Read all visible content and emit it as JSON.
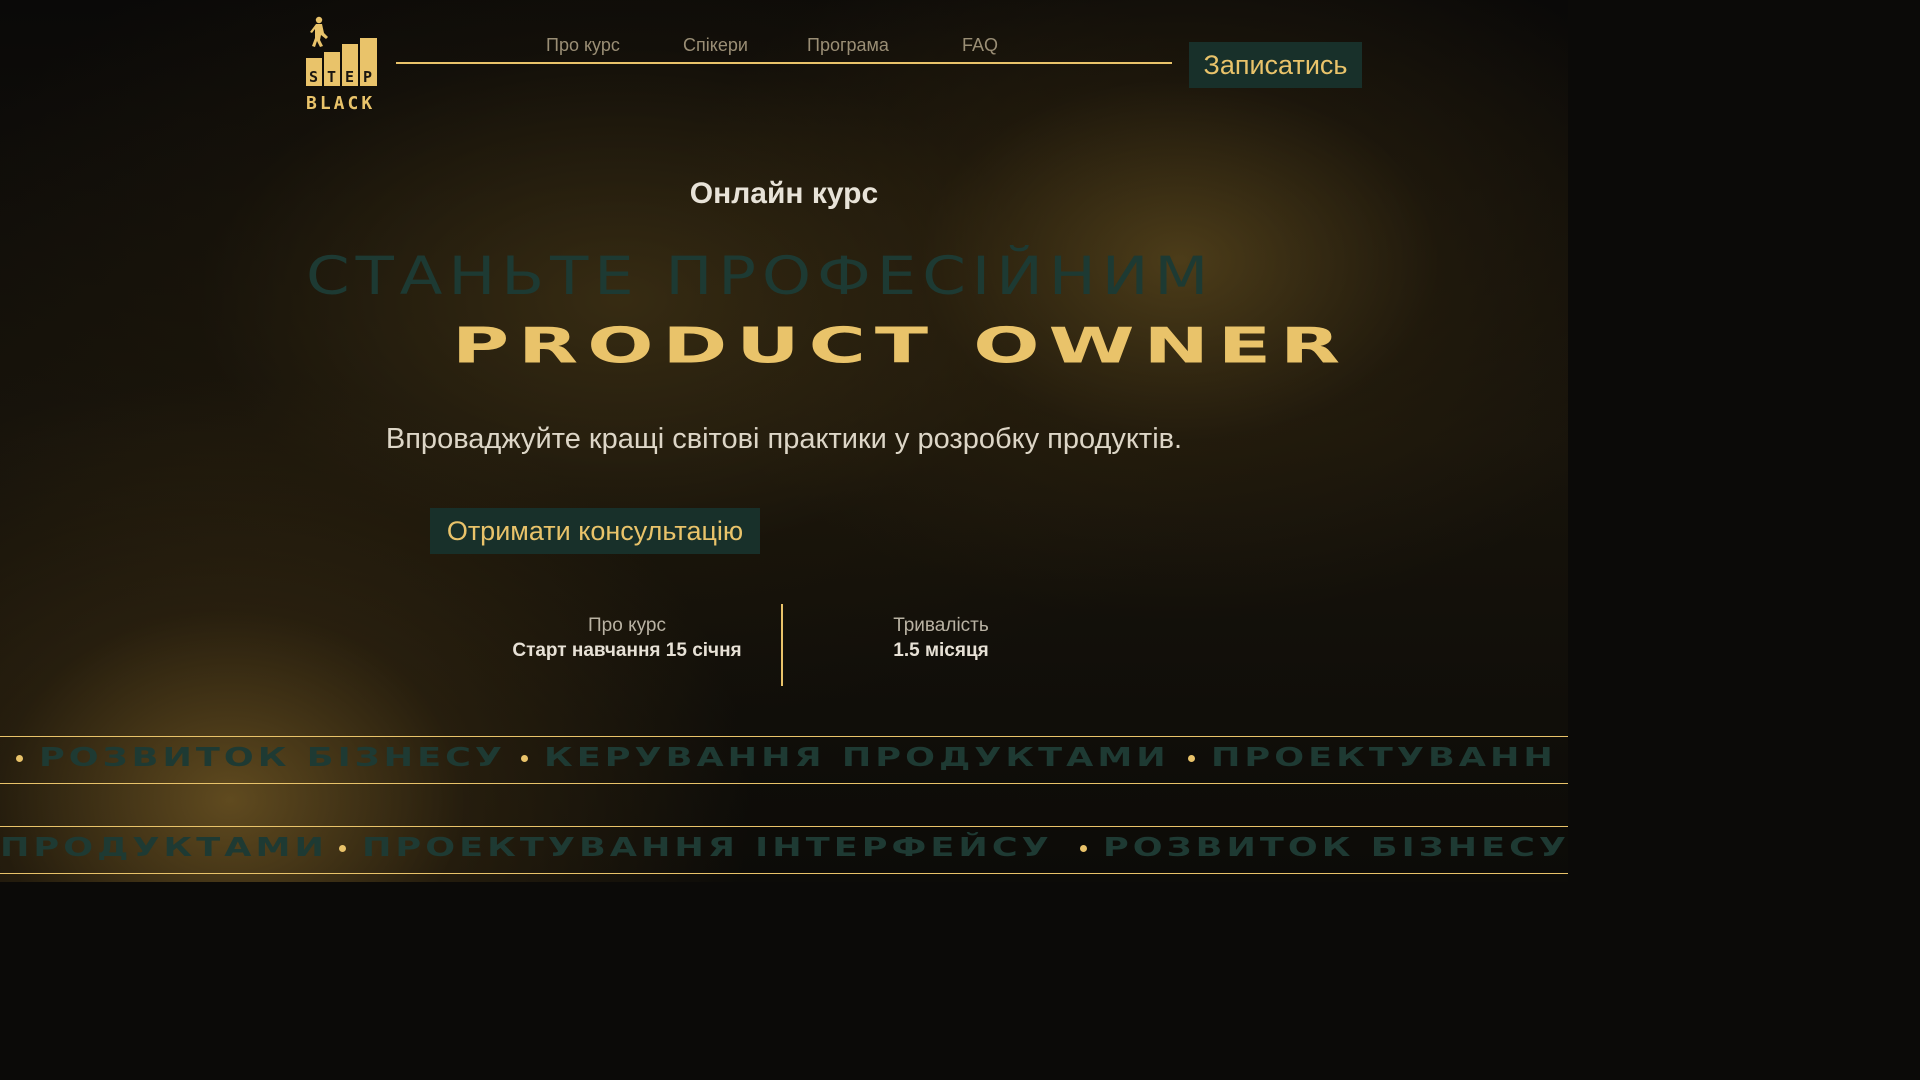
{
  "brand": {
    "logo_line1": "STEP",
    "logo_line2": "BLACK",
    "gold": "#e9c36a",
    "dark_green": "#18302a"
  },
  "nav": {
    "links": [
      "Про курс",
      "Спікери",
      "Програма",
      "FAQ"
    ],
    "cta_label": "Записатись"
  },
  "hero": {
    "kicker": "Онлайн курс",
    "headline_line1": "СТАНЬТЕ ПРОФЕСІЙНИМ",
    "headline_line2": "PRODUCT OWNER",
    "subtitle": "Впроваджуйте кращі світові практики у розробку продуктів.",
    "cta_label": "Отримати консультацію"
  },
  "info": [
    {
      "label": "Про курс",
      "value": "Старт навчання 15 січня"
    },
    {
      "label": "Тривалість",
      "value": "1.5 місяця"
    }
  ],
  "ticker_top": [
    "РОЗВИТОК БІЗНЕСУ",
    "КЕРУВАННЯ ПРОДУКТАМИ",
    "ПРОЕКТУВАНН"
  ],
  "ticker_bottom": [
    "ПРОДУКТАМИ",
    "ПРОЕКТУВАННЯ ІНТЕРФЕЙСУ",
    "РОЗВИТОК БІЗНЕСУ"
  ]
}
